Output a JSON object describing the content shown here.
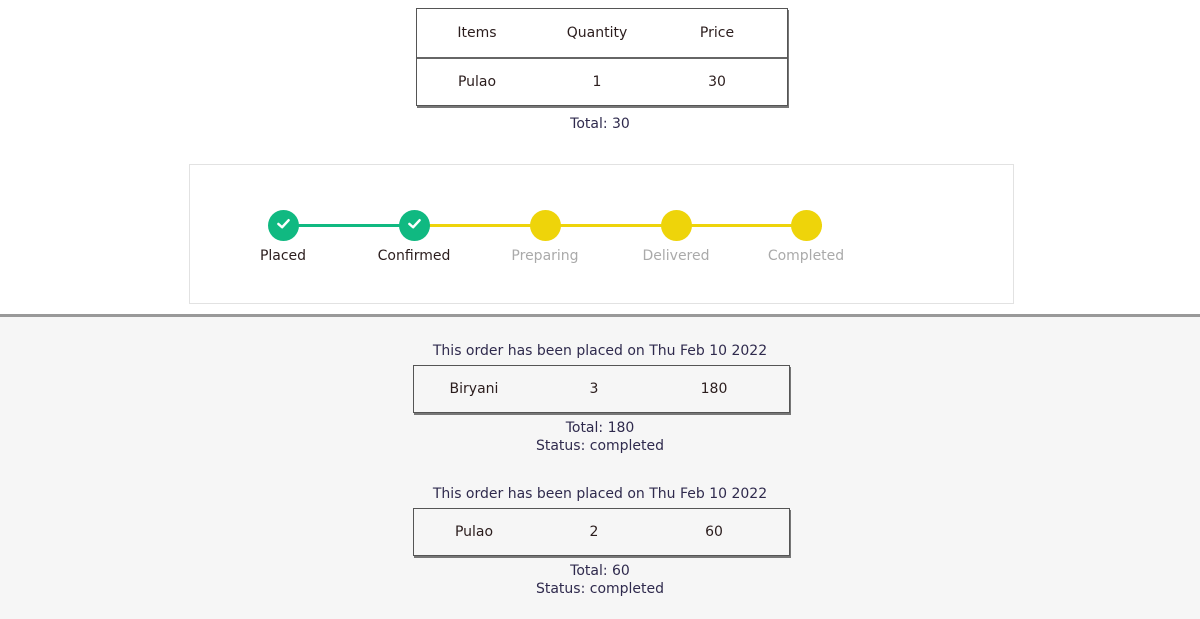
{
  "current_order": {
    "headers": [
      "Items",
      "Quantity",
      "Price"
    ],
    "rows": [
      [
        "Pulao",
        "1",
        "30"
      ]
    ],
    "total": "Total: 30"
  },
  "tracker": {
    "colors": {
      "done": "#10b981",
      "pending": "#eed40a",
      "label_done": "#2b1d1d",
      "label_pending": "#aaaaaa"
    },
    "steps": [
      {
        "label": "Placed",
        "done": true
      },
      {
        "label": "Confirmed",
        "done": true
      },
      {
        "label": "Preparing",
        "done": false
      },
      {
        "label": "Delivered",
        "done": false
      },
      {
        "label": "Completed",
        "done": false
      }
    ]
  },
  "history": {
    "orders": [
      {
        "heading": "This order has been placed on Thu Feb 10 2022",
        "row": [
          "Biryani",
          "3",
          "180"
        ],
        "total": "Total: 180",
        "status": "Status: completed"
      },
      {
        "heading": "This order has been placed on Thu Feb 10 2022",
        "row": [
          "Pulao",
          "2",
          "60"
        ],
        "total": "Total: 60",
        "status": "Status: completed"
      }
    ]
  }
}
